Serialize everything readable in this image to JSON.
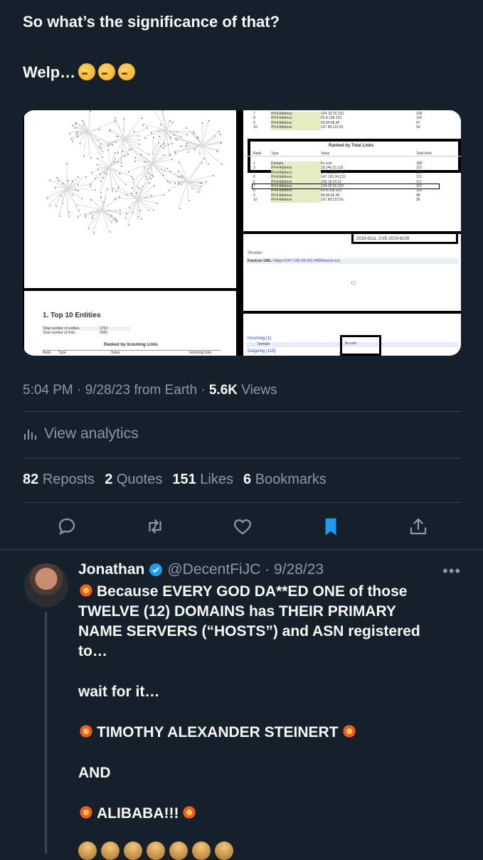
{
  "tweet": {
    "line1": "So what’s the significance of that?",
    "line2": "Welp…",
    "emoji_line2": [
      "thinking-face-icon",
      "thinking-face-icon",
      "thinking-face-icon"
    ],
    "media": {
      "table_rows_top": [
        [
          "7",
          "IPv4 Address",
          "104.18.26.153",
          "109"
        ],
        [
          "8",
          "IPv4 Address",
          "65.8.158.123",
          "100"
        ],
        [
          "9",
          "IPv4 Address",
          "99.84.66.45",
          "97"
        ],
        [
          "10",
          "IPv4 Address",
          "167.89.115.56",
          "94"
        ]
      ],
      "ranked_title": "Ranked by Total Links",
      "ranked_header": [
        "Rank",
        "Type",
        "Value",
        "Total links"
      ],
      "ranked_rows": [
        [
          "1",
          "Domain",
          "flx.com",
          "188"
        ],
        [
          "3",
          "IPv4 Address",
          "18.246.31.131",
          "121"
        ],
        [
          "4",
          "IPv4 Address",
          "104.18.226.45",
          "120"
        ],
        [
          "5",
          "IPv4 Address",
          "147.139.34.231",
          "115"
        ],
        [
          "6",
          "IPv4 Address",
          "104.18.33.31",
          "111"
        ],
        [
          "7",
          "IPv4 Address",
          "104.18.26.153",
          "110"
        ],
        [
          "8",
          "IPv4 Address",
          "65.8.158.123",
          "101"
        ],
        [
          "9",
          "IPv4 Address",
          "99.84.66.45",
          "98"
        ],
        [
          "10",
          "IPv4 Address",
          "167.89.115.56",
          "95"
        ]
      ],
      "cve": "2019-6111, CVE-2019-6109",
      "shodan": "Shodan",
      "favicon_label": "Favicon URL:",
      "favicon_url": "https://147.139.34.231:443/favicon.ico",
      "top10_title": "1. Top 10 Entities",
      "top10_rows": [
        [
          "Total number of entities",
          "1752"
        ],
        [
          "Total number of links",
          "2960"
        ]
      ],
      "incoming_title": "Ranked by Incoming Links",
      "incoming_header": [
        "Rank",
        "Type",
        "Value",
        "Incoming links"
      ],
      "incoming_label": "Incoming (1)",
      "incoming_domain": "Domain",
      "incoming_value": "flx.com",
      "outgoing_label": "Outgoing (115)"
    },
    "timestamp": "5:04 PM · 9/28/23 from Earth · ",
    "views_count": "5.6K",
    "views_label": " Views",
    "analytics": "View analytics",
    "stats": [
      {
        "count": "82",
        "label": "Reposts"
      },
      {
        "count": "2",
        "label": "Quotes"
      },
      {
        "count": "151",
        "label": "Likes"
      },
      {
        "count": "6",
        "label": "Bookmarks"
      }
    ]
  },
  "reply": {
    "name": "Jonathan",
    "handle": "@DecentFiJC · 9/28/23",
    "more": "•••",
    "lines": [
      "Because EVERY GOD DA**ED ONE of those",
      "TWELVE (12) DOMAINS has THEIR PRIMARY",
      "NAME SERVERS (“HOSTS”) and ASN registered",
      "to…",
      "wait for it…",
      "TIMOTHY ALEXANDER STEINERT",
      "AND",
      "ALIBABA!!!"
    ]
  },
  "colors": {
    "background": "#15202b",
    "muted": "#8b98a5",
    "accent": "#1d9bf0"
  }
}
